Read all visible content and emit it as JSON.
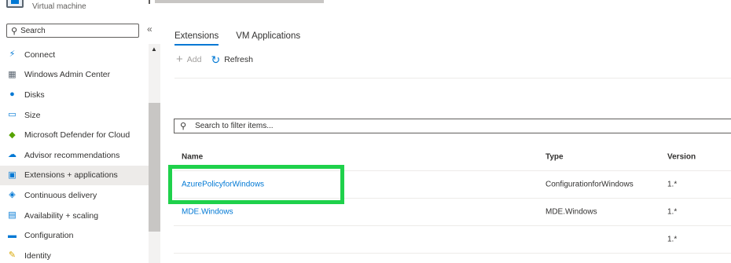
{
  "header": {
    "subtitle": "Virtual machine"
  },
  "sidebar": {
    "search_placeholder": "Search",
    "collapse_glyph": "«",
    "items": [
      {
        "label": "Connect",
        "icon": "plug-icon",
        "glyph": "⚡",
        "color": "#0078d4"
      },
      {
        "label": "Windows Admin Center",
        "icon": "server-icon",
        "glyph": "▦",
        "color": "#5a6570"
      },
      {
        "label": "Disks",
        "icon": "disk-icon",
        "glyph": "●",
        "color": "#0078d4"
      },
      {
        "label": "Size",
        "icon": "monitor-icon",
        "glyph": "▭",
        "color": "#0078d4"
      },
      {
        "label": "Microsoft Defender for Cloud",
        "icon": "shield-icon",
        "glyph": "◆",
        "color": "#57a300"
      },
      {
        "label": "Advisor recommendations",
        "icon": "cloud-icon",
        "glyph": "☁",
        "color": "#0078d4"
      },
      {
        "label": "Extensions + applications",
        "icon": "extensions-icon",
        "glyph": "▣",
        "color": "#0078d4",
        "active": true
      },
      {
        "label": "Continuous delivery",
        "icon": "delivery-icon",
        "glyph": "◈",
        "color": "#0078d4"
      },
      {
        "label": "Availability + scaling",
        "icon": "scaling-icon",
        "glyph": "▤",
        "color": "#0078d4"
      },
      {
        "label": "Configuration",
        "icon": "config-icon",
        "glyph": "▬",
        "color": "#0078d4"
      },
      {
        "label": "Identity",
        "icon": "key-icon",
        "glyph": "✎",
        "color": "#d8a600"
      }
    ]
  },
  "main": {
    "tabs": [
      {
        "label": "Extensions",
        "active": true
      },
      {
        "label": "VM Applications",
        "active": false
      }
    ],
    "toolbar": {
      "add_label": "Add",
      "refresh_label": "Refresh"
    },
    "filter_placeholder": "Search to filter items...",
    "table": {
      "columns": [
        "Name",
        "Type",
        "Version"
      ],
      "rows": [
        {
          "name": "AzurePolicyforWindows",
          "type": "ConfigurationforWindows",
          "version": "1.*"
        },
        {
          "name": "MDE.Windows",
          "type": "MDE.Windows",
          "version": "1.*"
        },
        {
          "name": "",
          "type": "",
          "version": "1.*"
        }
      ]
    }
  },
  "colors": {
    "accent": "#0078d4",
    "highlight": "#1fd14b"
  }
}
